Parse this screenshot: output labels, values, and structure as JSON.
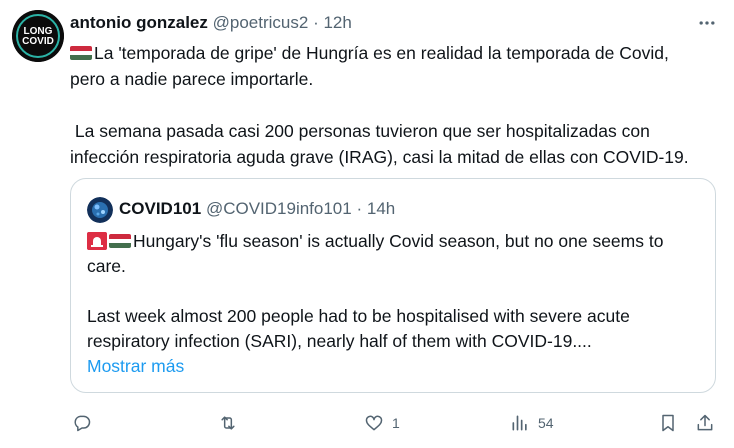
{
  "author": {
    "display_name": "antonio gonzalez",
    "handle": "@poetricus2",
    "separator": "·",
    "time": "12h",
    "avatar_text": "LONG COVID"
  },
  "tweet": {
    "line1": "La 'temporada de gripe' de Hungría es en realidad la temporada de Covid,",
    "line2": "pero a nadie parece importarle.",
    "line3": " La semana pasada casi 200 personas tuvieron que ser hospitalizadas con",
    "line4": "infección respiratoria aguda grave (IRAG), casi la mitad de ellas con COVID-19."
  },
  "quote": {
    "display_name": "COVID101",
    "handle": "@COVID19info101",
    "separator": "·",
    "time": "14h",
    "line1": "Hungary's 'flu season' is actually Covid season, but no one seems to",
    "line2": "care.",
    "line3": "Last week almost 200 people had to be hospitalised with severe acute",
    "line4": "respiratory infection (SARI), nearly half of them with COVID-19....",
    "show_more": "Mostrar más"
  },
  "actions": {
    "likes": "1",
    "views": "54"
  },
  "colors": {
    "text": "#0f1419",
    "secondary": "#536471",
    "link": "#1d9bf0",
    "border": "#cfd9de"
  },
  "icons": [
    "more-icon",
    "hungary-flag-icon",
    "siren-icon",
    "reply-icon",
    "retweet-icon",
    "like-icon",
    "views-icon",
    "bookmark-icon",
    "share-icon"
  ]
}
